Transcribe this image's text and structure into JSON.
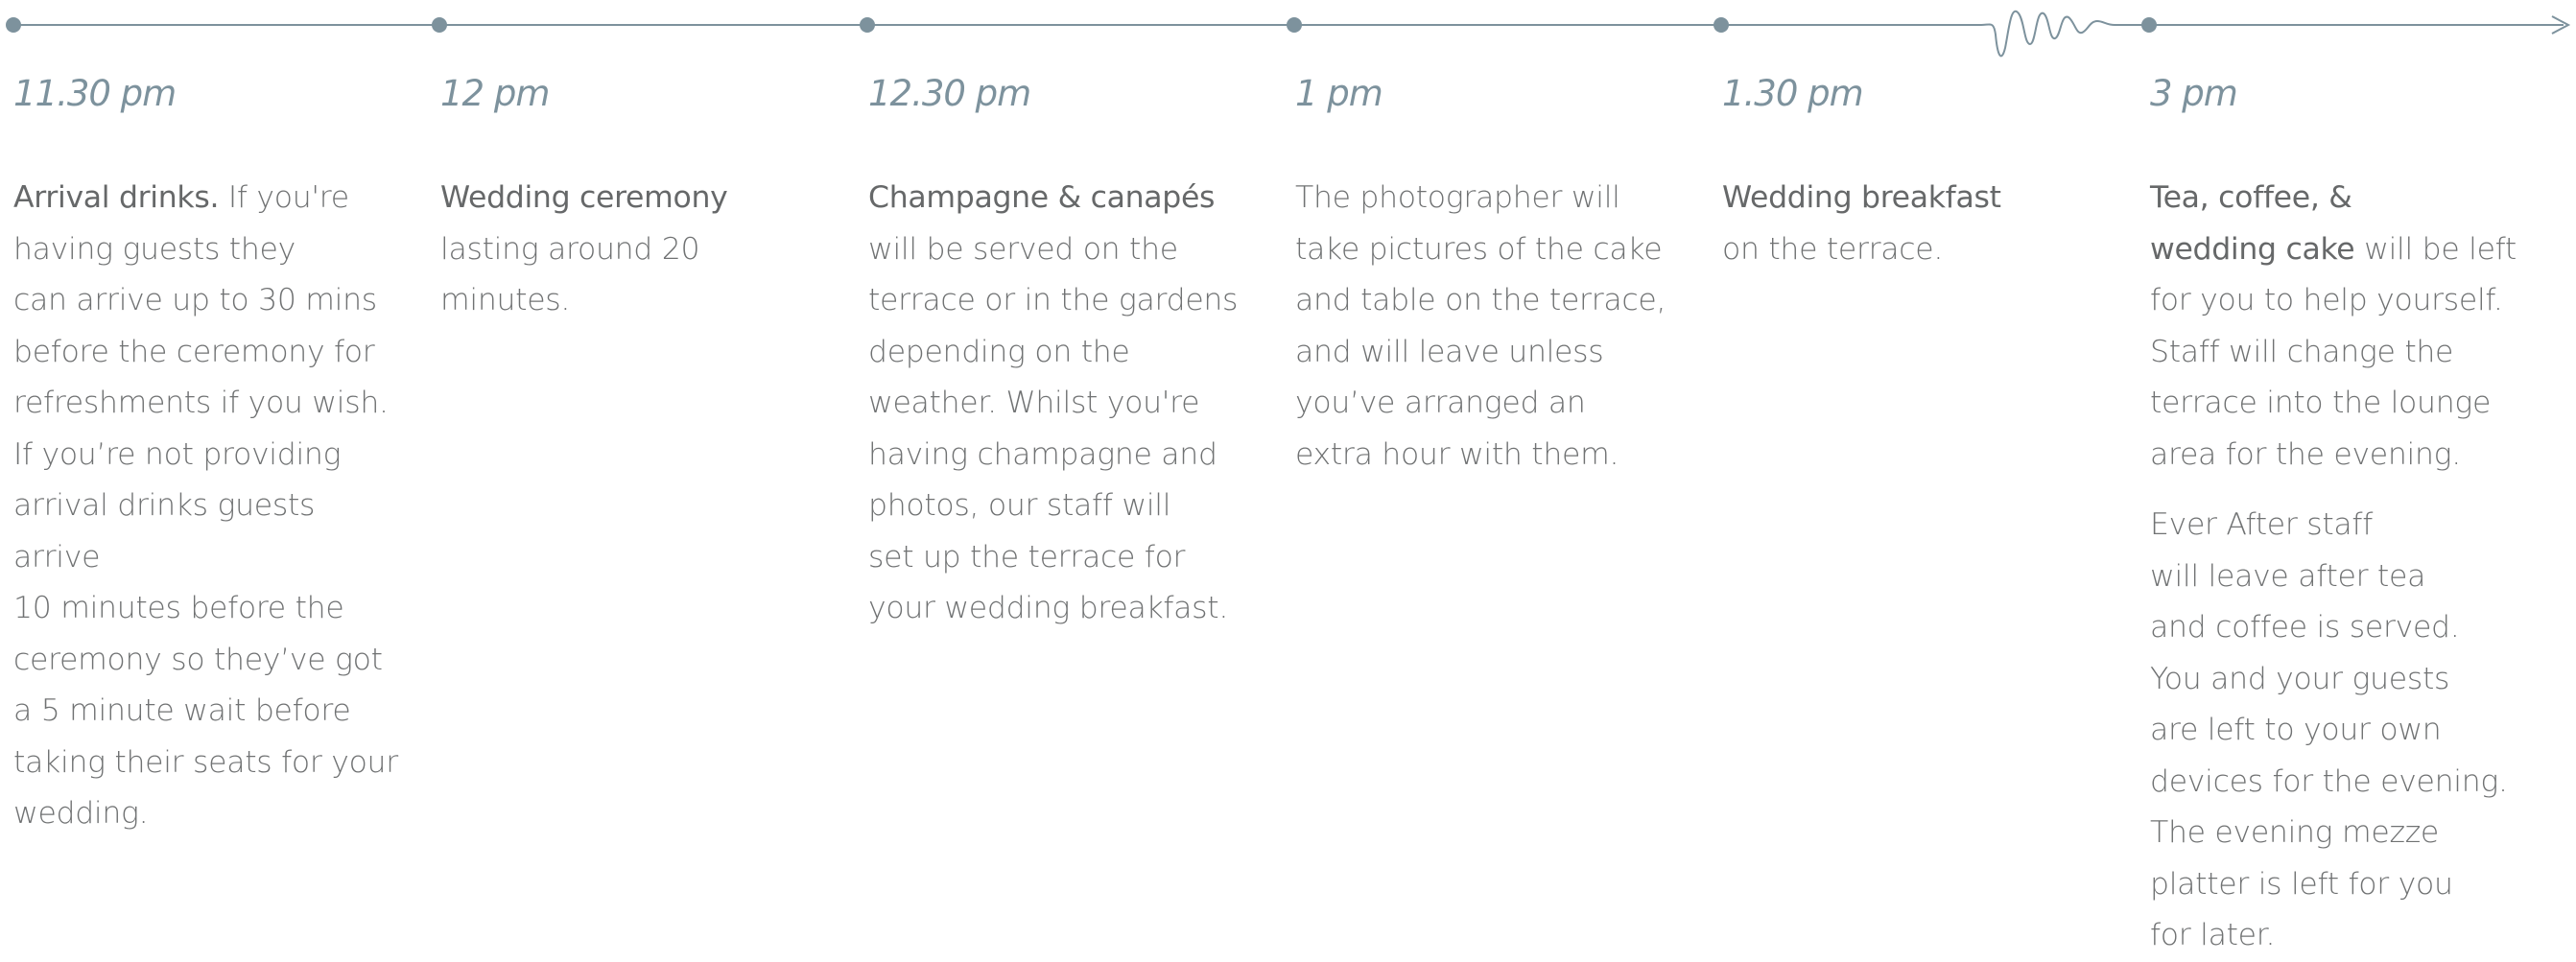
{
  "timeline": {
    "line_color": "#7d929d",
    "events": [
      {
        "time": "11.30 pm",
        "paragraphs": [
          {
            "lead": "Arrival drinks.",
            "text": " If you're\nhaving guests they\ncan arrive up to 30 mins\nbefore the ceremony for\nrefreshments if you wish.\nIf you’re not providing\narrival drinks guests arrive\n10 minutes before the\nceremony so they’ve got\na 5 minute wait before\ntaking their seats for your\nwedding."
          }
        ]
      },
      {
        "time": "12 pm",
        "paragraphs": [
          {
            "lead": "Wedding ceremony",
            "text": "\nlasting around 20 minutes."
          }
        ]
      },
      {
        "time": "12.30 pm",
        "paragraphs": [
          {
            "lead": "Champagne & canapés",
            "text": "\nwill be served on the\nterrace or in the gardens\ndepending on the\nweather. Whilst you're\nhaving champagne and\nphotos, our staff will\nset up the terrace for\nyour wedding breakfast."
          }
        ]
      },
      {
        "time": "1 pm",
        "paragraphs": [
          {
            "lead": "",
            "text": "The photographer will\ntake pictures of the cake\nand table on the terrace,\nand will leave unless\nyou’ve arranged an\nextra hour with them."
          }
        ]
      },
      {
        "time": "1.30 pm",
        "paragraphs": [
          {
            "lead": "Wedding breakfast",
            "text": "\non the terrace."
          }
        ]
      },
      {
        "time": "3 pm",
        "paragraphs": [
          {
            "lead": "Tea, coffee, &\nwedding cake",
            "text": " will be left\nfor you to help yourself.\nStaff will change the\nterrace into the lounge\narea for the evening."
          },
          {
            "lead": "",
            "text": "Ever After staff\nwill leave after tea\nand coffee is served.\nYou and your guests\nare left to your own\ndevices for the evening.\nThe evening mezze\nplatter is left for you\nfor later."
          }
        ]
      }
    ]
  }
}
